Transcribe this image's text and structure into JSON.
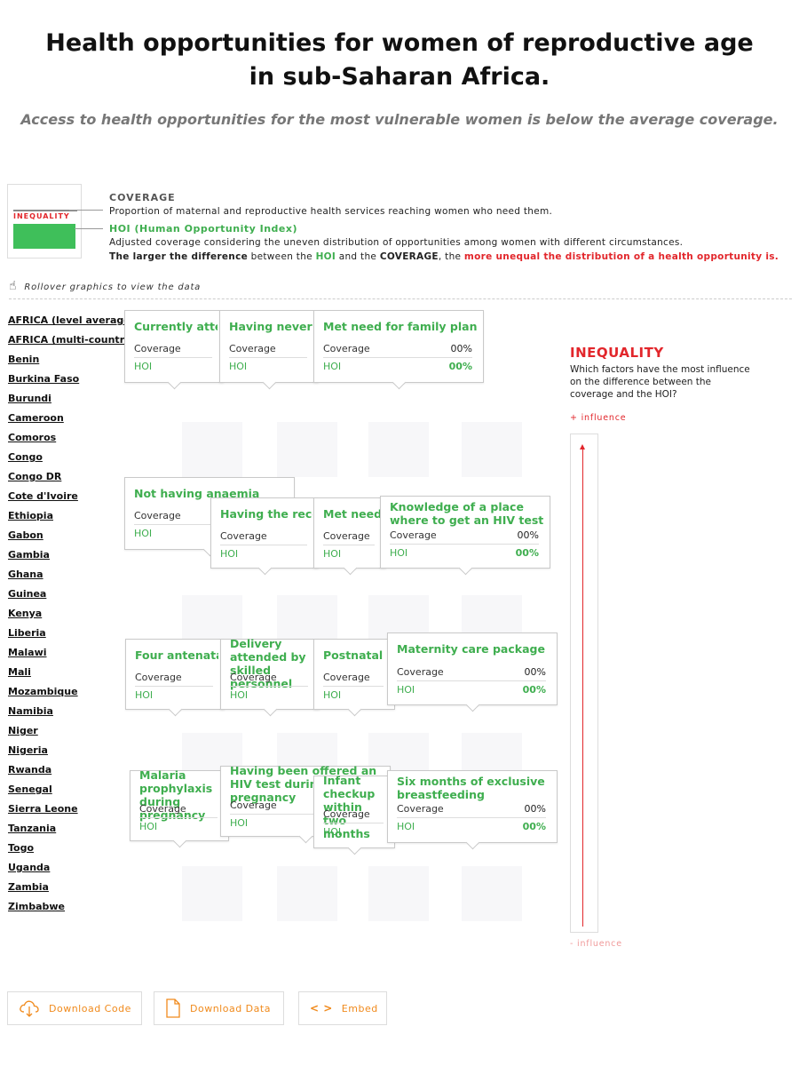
{
  "header": {
    "title_line1": "Health opportunities for women of reproductive age",
    "title_line2": "in sub-Saharan Africa.",
    "subtitle": "Access to health opportunities for the most vulnerable women is below the average coverage."
  },
  "legend": {
    "inequality_tag": "INEQUALITY",
    "coverage_label": "COVERAGE",
    "coverage_desc": "Proportion of maternal and reproductive health services reaching women who need them.",
    "hoi_label": "HOI (Human Opportunity Index)",
    "hoi_desc": "Adjusted coverage considering the uneven distribution of opportunities among women with different circumstances.",
    "diff_1": "The larger the difference",
    "diff_2": " between the ",
    "diff_hoi": "HOI",
    "diff_3": " and the ",
    "diff_cov": "COVERAGE",
    "diff_4": ", the ",
    "diff_red": "more unequal the distribution of a health opportunity is.",
    "rollover": "Rollover graphics to view the data",
    "colors": {
      "coverage": "#555555",
      "hoi": "#3fae4f",
      "inequality": "#e2262b"
    }
  },
  "countries": [
    "AFRICA (level average)",
    "AFRICA (multi-country)",
    "Benin",
    "Burkina Faso",
    "Burundi",
    "Cameroon",
    "Comoros",
    "Congo",
    "Congo DR",
    "Cote d'Ivoire",
    "Ethiopia",
    "Gabon",
    "Gambia",
    "Ghana",
    "Guinea",
    "Kenya",
    "Liberia",
    "Malawi",
    "Mali",
    "Mozambique",
    "Namibia",
    "Niger",
    "Nigeria",
    "Rwanda",
    "Senegal",
    "Sierra Leone",
    "Tanzania",
    "Togo",
    "Uganda",
    "Zambia",
    "Zimbabwe"
  ],
  "chart_data": {
    "type": "table",
    "row_labels": [
      "Coverage",
      "HOI"
    ],
    "indicators": [
      {
        "title": "Currently attending school",
        "coverage": "",
        "hoi": ""
      },
      {
        "title": "Having never been married",
        "coverage": "",
        "hoi": ""
      },
      {
        "title": "Met need for family planning",
        "coverage": "00%",
        "hoi": "00%"
      },
      {
        "title": "Not having anaemia",
        "coverage": "",
        "hoi": ""
      },
      {
        "title": "Having the recommended",
        "coverage": "",
        "hoi": ""
      },
      {
        "title": "Met need for",
        "coverage": "",
        "hoi": ""
      },
      {
        "title": "Knowledge of a place where to get an HIV test",
        "coverage": "00%",
        "hoi": "00%"
      },
      {
        "title": "Four antenatal care",
        "coverage": "",
        "hoi": ""
      },
      {
        "title": "Delivery attended by skilled personnel",
        "coverage": "",
        "hoi": ""
      },
      {
        "title": "Postnatal check",
        "coverage": "",
        "hoi": ""
      },
      {
        "title": "Maternity care package",
        "coverage": "00%",
        "hoi": "00%"
      },
      {
        "title": "Malaria prophylaxis during pregnancy",
        "coverage": "",
        "hoi": ""
      },
      {
        "title": "Having been offered an HIV test during pregnancy",
        "coverage": "",
        "hoi": ""
      },
      {
        "title": "Infant checkup within two months",
        "coverage": "",
        "hoi": ""
      },
      {
        "title": "Six months of exclusive breastfeeding",
        "coverage": "00%",
        "hoi": "00%"
      }
    ]
  },
  "inequality_panel": {
    "title": "INEQUALITY",
    "question": "Which factors have the most influence on the difference between the coverage and the HOI?",
    "plus": "+ influence",
    "minus": "- influence"
  },
  "buttons": {
    "download_code": "Download Code",
    "download_data": "Download Data",
    "embed": "Embed"
  }
}
